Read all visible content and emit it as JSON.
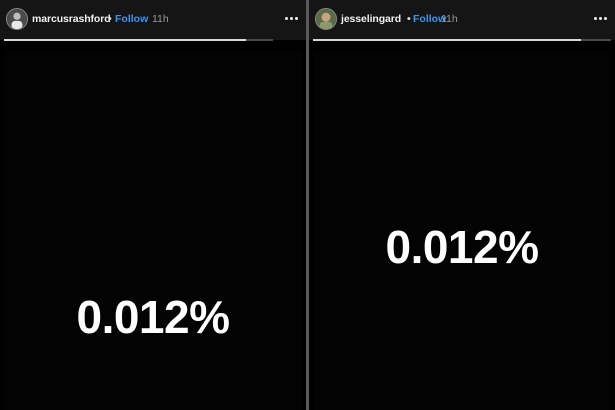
{
  "stories": [
    {
      "username": "marcusrashford",
      "separator": "•",
      "follow_label": "Follow",
      "time": "11h",
      "story_text": "0.012%",
      "progress": 0.9,
      "avatar_icon": "profile-avatar"
    },
    {
      "username": "jesselingard",
      "separator": "•",
      "follow_label": "Follow",
      "time": "11h",
      "story_text": "0.012%",
      "progress": 0.9,
      "avatar_icon": "profile-avatar"
    }
  ],
  "more_icon": "more-options-icon",
  "colors": {
    "follow": "#3897f0",
    "story_background": "#000000",
    "story_text": "#ffffff"
  }
}
